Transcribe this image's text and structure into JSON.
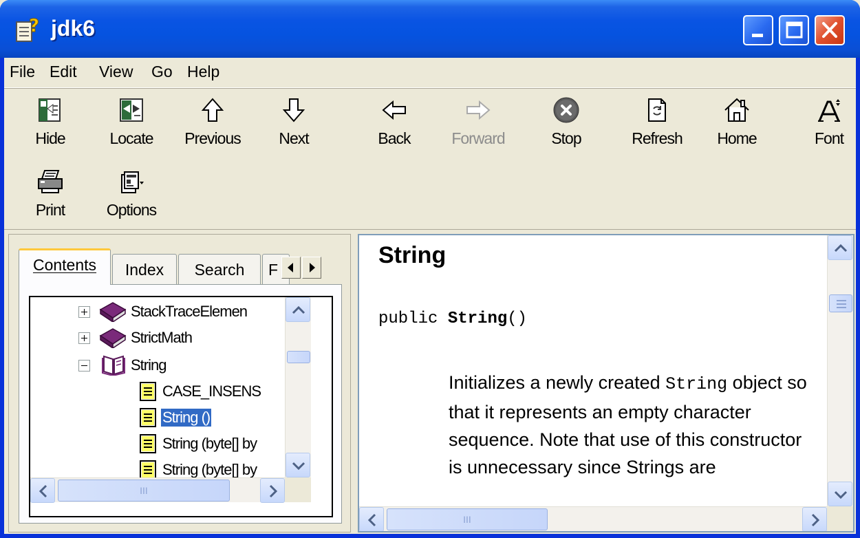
{
  "window": {
    "title": "jdk6",
    "colors": {
      "titlebar": "#0a54e3",
      "close": "#e0502e",
      "face": "#ece9d8",
      "selection": "#316ac5"
    }
  },
  "menu": {
    "items": [
      "File",
      "Edit",
      "View",
      "Go",
      "Help"
    ]
  },
  "toolbar": {
    "buttons": [
      {
        "label": "Hide",
        "icon": "hide-icon"
      },
      {
        "label": "Locate",
        "icon": "locate-icon"
      },
      {
        "label": "Previous",
        "icon": "arrow-up-icon"
      },
      {
        "label": "Next",
        "icon": "arrow-down-icon"
      },
      {
        "label": "Back",
        "icon": "arrow-left-icon"
      },
      {
        "label": "Forward",
        "icon": "arrow-right-icon",
        "disabled": true
      },
      {
        "label": "Stop",
        "icon": "stop-icon"
      },
      {
        "label": "Refresh",
        "icon": "refresh-icon"
      },
      {
        "label": "Home",
        "icon": "home-icon"
      },
      {
        "label": "Font",
        "icon": "font-icon"
      },
      {
        "label": "Print",
        "icon": "print-icon"
      },
      {
        "label": "Options",
        "icon": "options-icon"
      }
    ]
  },
  "nav": {
    "tabs": [
      "Contents",
      "Index",
      "Search",
      "F"
    ],
    "active_tab": "Contents",
    "tree": [
      {
        "label": "StackTraceElemen",
        "type": "book-closed",
        "expander": "+"
      },
      {
        "label": "StrictMath",
        "type": "book-closed",
        "expander": "+"
      },
      {
        "label": "String",
        "type": "book-open",
        "expander": "-"
      },
      {
        "label": "CASE_INSENS",
        "type": "page"
      },
      {
        "label": "String ()",
        "type": "page",
        "selected": true
      },
      {
        "label": "String (byte[] by",
        "type": "page"
      },
      {
        "label": "String (byte[] by",
        "type": "page"
      }
    ]
  },
  "content": {
    "heading": "String",
    "signature_prefix": "public ",
    "signature_name": "String",
    "signature_suffix": "()",
    "desc_1": "Initializes a newly created ",
    "desc_code": "String",
    "desc_2": " object so that it represents an empty character sequence. Note that use of this constructor is unnecessary since Strings are"
  },
  "scrollbars": {
    "grip": "III"
  }
}
